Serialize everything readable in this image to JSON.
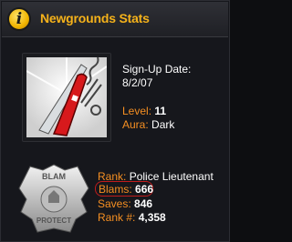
{
  "header": {
    "icon": "info-icon",
    "icon_glyph": "i",
    "title": "Newgrounds Stats"
  },
  "profile": {
    "avatar_icon": "swiss-army-knife-icon",
    "signup_label": "Sign-Up Date:",
    "signup_date": "8/2/07",
    "level_label": "Level:",
    "level_value": "11",
    "aura_label": "Aura:",
    "aura_value": "Dark"
  },
  "rank": {
    "badge_icon": "police-badge-icon",
    "badge_top_text": "BLAM",
    "badge_bottom_text": "PROTECT",
    "rank_label": "Rank:",
    "rank_value": "Police Lieutenant",
    "blams_label": "Blams:",
    "blams_value": "666",
    "saves_label": "Saves:",
    "saves_value": "846",
    "ranknum_label": "Rank #:",
    "ranknum_value": "4,358"
  },
  "colors": {
    "title": "#f5b21a",
    "label": "#f58f22",
    "value": "#ffffff",
    "highlight_border": "#c11c1c"
  }
}
